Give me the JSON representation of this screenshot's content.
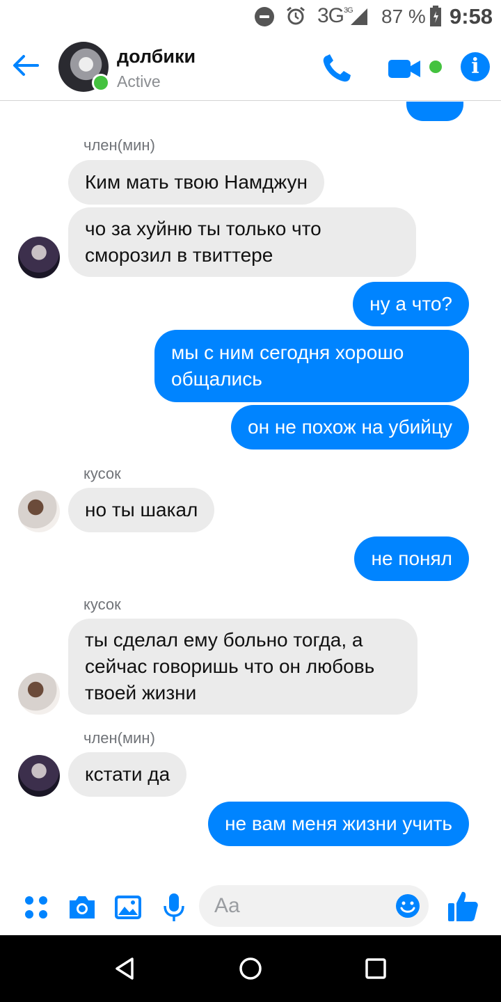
{
  "status_bar": {
    "network": "3G",
    "network_sup": "3G",
    "battery": "87 %",
    "time": "9:58",
    "icons": [
      "do-not-disturb-icon",
      "alarm-icon",
      "signal-icon",
      "battery-icon"
    ]
  },
  "header": {
    "name": "долбики",
    "status": "Active",
    "icons": [
      "back-arrow-icon",
      "phone-icon",
      "video-camera-icon",
      "info-icon"
    ]
  },
  "messages": [
    {
      "sender": "член(мин)"
    },
    {
      "text": "Ким мать твою Намджун"
    },
    {
      "text": "чо за хуйню ты только что сморозил в твиттере"
    },
    {
      "text": "ну а что?"
    },
    {
      "text": "мы с ним сегодня хорошо общались"
    },
    {
      "text": "он не похож на убийцу"
    },
    {
      "sender": "кусок"
    },
    {
      "text": "но ты шакал"
    },
    {
      "text": "не понял"
    },
    {
      "sender": "кусок"
    },
    {
      "text": "ты сделал ему больно тогда, а сейчас говоришь что он любовь твоей жизни"
    },
    {
      "sender": "член(мин)"
    },
    {
      "text": "кстати да"
    },
    {
      "text": "не вам меня жизни учить"
    }
  ],
  "composer": {
    "placeholder": "Aa",
    "icons": [
      "more-dots-icon",
      "camera-icon",
      "gallery-icon",
      "microphone-icon",
      "emoji-icon",
      "thumbs-up-icon"
    ]
  },
  "colors": {
    "accent": "#0084ff",
    "active": "#44c23f",
    "incoming_bubble": "#ebebeb"
  }
}
